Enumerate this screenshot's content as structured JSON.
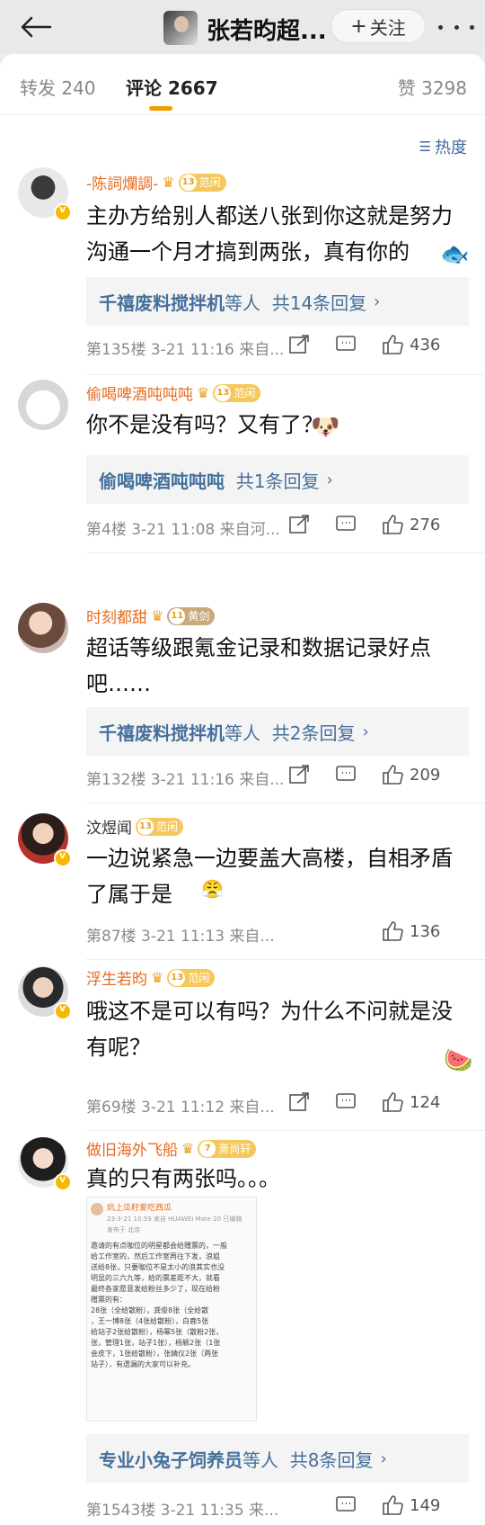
{
  "header": {
    "title": "张若昀超...",
    "follow_label": "关注"
  },
  "tabs": {
    "repost": "转发 240",
    "comments": "评论 2667",
    "likes": "赞 3298"
  },
  "sort_label": "热度",
  "comments": [
    {
      "name": "-陈詞爛調-",
      "level": "13",
      "badge": "范闲",
      "text": "主办方给别人都送八张到你这就是努力沟通一个月才搞到两张，真有你的",
      "reply_user": "千禧废料搅拌机",
      "reply_suffix": "等人",
      "reply_count": "共14条回复",
      "meta": "第135楼  3-21 11:16  来自...",
      "likes": "436"
    },
    {
      "name": "偷喝啤酒吨吨吨",
      "level": "13",
      "badge": "范闲",
      "text": "你不是没有吗？又有了？",
      "reply_user": "偷喝啤酒吨吨吨",
      "reply_suffix": "",
      "reply_count": "共1条回复",
      "meta": "第4楼  3-21 11:08  来自河...",
      "likes": "276"
    },
    {
      "name": "时刻都甜",
      "level": "11",
      "badge": "黄剑",
      "text": "超话等级跟氪金记录和数据记录好点吧……",
      "reply_user": "千禧废料搅拌机",
      "reply_suffix": "等人",
      "reply_count": "共2条回复",
      "meta": "第132楼  3-21 11:16  来自...",
      "likes": "209"
    },
    {
      "name": "汶煜闻",
      "level": "13",
      "badge": "范闲",
      "text": "一边说紧急一边要盖大高楼，自相矛盾了属于是",
      "meta": "第87楼  3-21 11:13  来自...",
      "likes": "136"
    },
    {
      "name": "浮生若昀",
      "level": "13",
      "badge": "范闲",
      "text": "哦这不是可以有吗？为什么不问就是没有呢？",
      "meta": "第69楼  3-21 11:12  来自...",
      "likes": "124"
    },
    {
      "name": "做旧海外飞船",
      "level": "7",
      "badge": "萧尚轩",
      "text": "真的只有两张吗。。。",
      "reply_user": "专业小兔子饲养员",
      "reply_suffix": "等人",
      "reply_count": "共8条回复",
      "meta": "第1543楼  3-21 11:35  来...",
      "likes": "149"
    }
  ],
  "embedded_post": {
    "name": "炕上瓜籽爱吃西瓜",
    "meta": "23-3-21 10:59  来自 HUAWEI Mate 20  已编辑",
    "location": "发布于 北京",
    "lines": [
      "邀请的有点咖位的明星都会给赠票的，一般",
      "给工作室的，然后工作室再往下发，浪姐",
      "送给8张，只要咖位不是太小的浪其实也没",
      "明显的三六九等，给的票差距不大，就看",
      "最终各家愿意发给粉丝多少了，现在给粉",
      "赠票的有：",
      "28张（全给散粉），龚俊8张（全给散",
      "，王一博8张（4张给散粉），白鹿5张",
      "给站子2张给散粉），杨幂5张（散粉2张，",
      "张，管理1张，站子1张），杨颖2张（1张",
      "会皮下，1张给散粉），张婧仪2张（两张",
      "站子），有遗漏的大家可以补充。"
    ]
  }
}
